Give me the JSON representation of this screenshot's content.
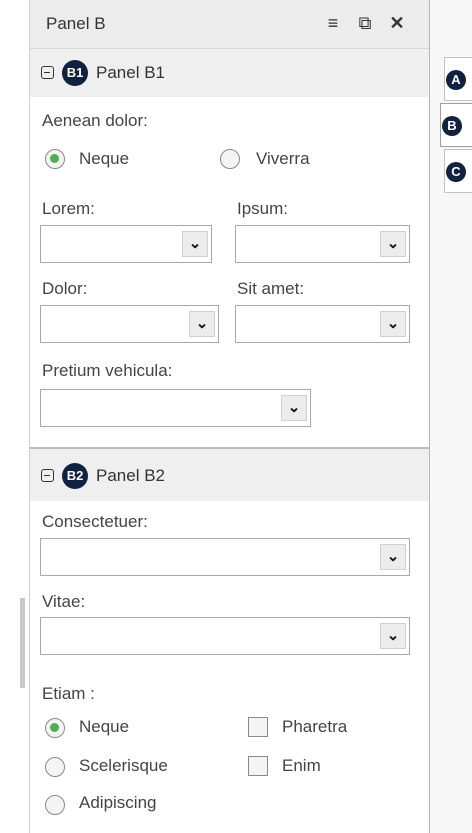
{
  "window": {
    "title": "Panel B"
  },
  "toolbar_icons": [
    "menu-icon",
    "popout-icon",
    "close-icon"
  ],
  "close_glyph": "✕",
  "menu_glyph": "≡",
  "popout_glyph": "⧉",
  "section1": {
    "badge": "B1",
    "title": "Panel B1",
    "radio_group_label": "Aenean dolor:",
    "radio_options": [
      "Neque",
      "Viverra"
    ],
    "selected": "Neque",
    "fields": {
      "lorem": {
        "label": "Lorem:",
        "value": ""
      },
      "ipsum": {
        "label": "Ipsum:",
        "value": ""
      },
      "dolor": {
        "label": "Dolor:",
        "value": ""
      },
      "sit_amet": {
        "label": "Sit amet:",
        "value": ""
      },
      "pretium": {
        "label": "Pretium vehicula:",
        "value": ""
      }
    }
  },
  "section2": {
    "badge": "B2",
    "title": "Panel B2",
    "fields": {
      "consectetuer": {
        "label": "Consectetuer:",
        "value": ""
      },
      "vitae": {
        "label": "Vitae:",
        "value": ""
      }
    },
    "etiam_label": "Etiam :",
    "radio_options": [
      "Neque",
      "Scelerisque",
      "Adipiscing"
    ],
    "selected": "Neque",
    "checkboxes": [
      "Pharetra",
      "Enim"
    ]
  },
  "side_tabs": [
    {
      "badge": "A",
      "active": false
    },
    {
      "badge": "B",
      "active": true
    },
    {
      "badge": "C",
      "active": false
    }
  ],
  "dropdown_glyph": "⌄"
}
